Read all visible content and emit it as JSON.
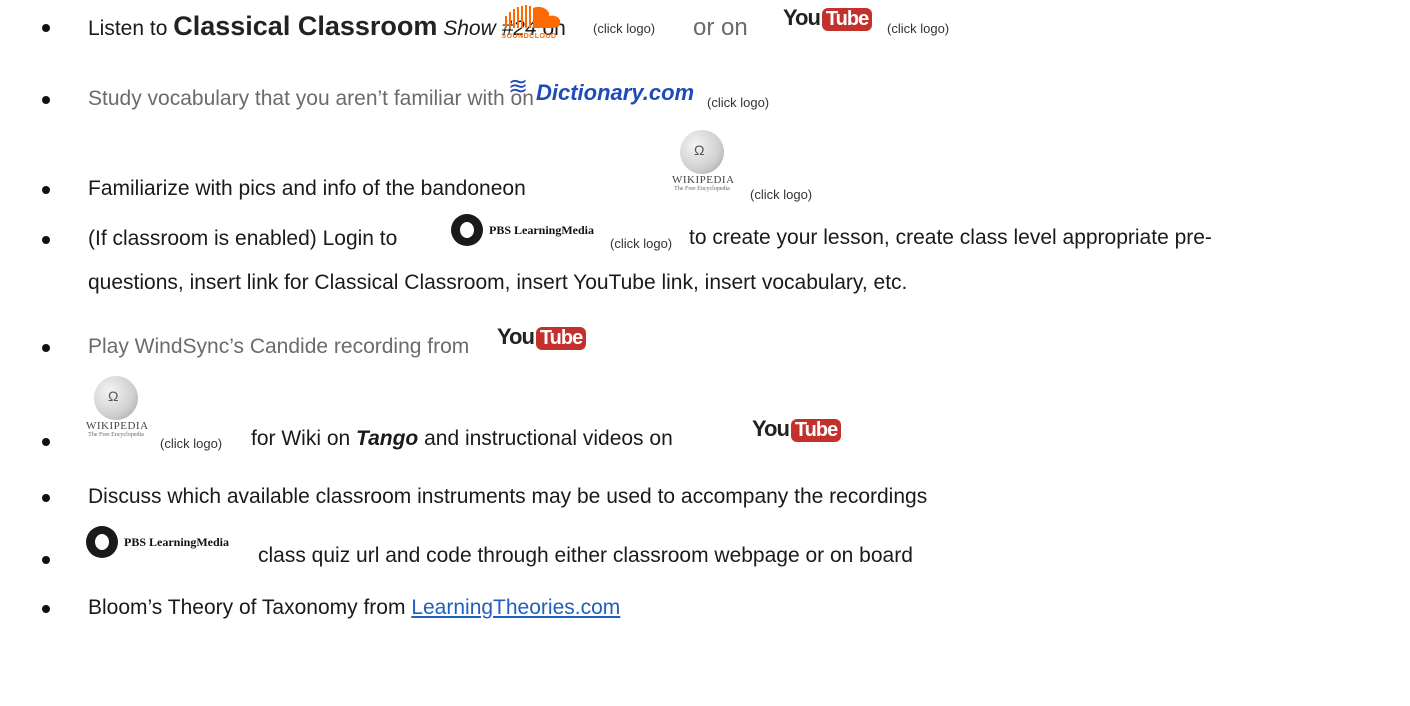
{
  "items": [
    {
      "pre": "Listen to ",
      "show_name": "Classical Classroom",
      "show_number": "Show #24",
      "on1": " on",
      "soundcloud_text": "SOUNDCLOUD",
      "click1": "(click logo)",
      "or_on": "or on",
      "youtube_you": "You",
      "youtube_tube": "Tube",
      "click2": "(click logo)"
    },
    {
      "text": "Study vocabulary that you aren’t familiar with on",
      "dict_logo": "Dictionary.com",
      "click": "(click logo)"
    },
    {
      "text": "Familiarize with pics and info of the bandoneon",
      "wiki_title": "WIKIPEDIA",
      "wiki_sub": "The Free Encyclopedia",
      "click": "(click logo)"
    },
    {
      "text": "(If classroom is enabled) Login to",
      "pbs_text": "PBS LearningMedia",
      "click": "(click logo)",
      "rest": "to create your lesson, create class level appropriate pre-",
      "line2": "questions, insert link for Classical Classroom, insert YouTube link, insert vocabulary, etc."
    },
    {
      "text": "Play WindSync’s Candide recording from",
      "youtube_you": "You",
      "youtube_tube": "Tube"
    },
    {
      "wiki_title": "WIKIPEDIA",
      "wiki_sub": "The Free Encyclopedia",
      "click": "(click logo)",
      "for_wiki": "for Wiki on ",
      "tango": "Tango",
      "rest": "  and instructional videos on",
      "youtube_you": "You",
      "youtube_tube": "Tube"
    },
    {
      "text": "Discuss which available classroom instruments may be used to accompany the recordings"
    },
    {
      "pbs_text": "PBS LearningMedia",
      "rest": "class quiz url and code through either classroom webpage or on board"
    },
    {
      "text": "Bloom’s Theory of Taxonomy from ",
      "link": "LearningTheories.com"
    }
  ]
}
